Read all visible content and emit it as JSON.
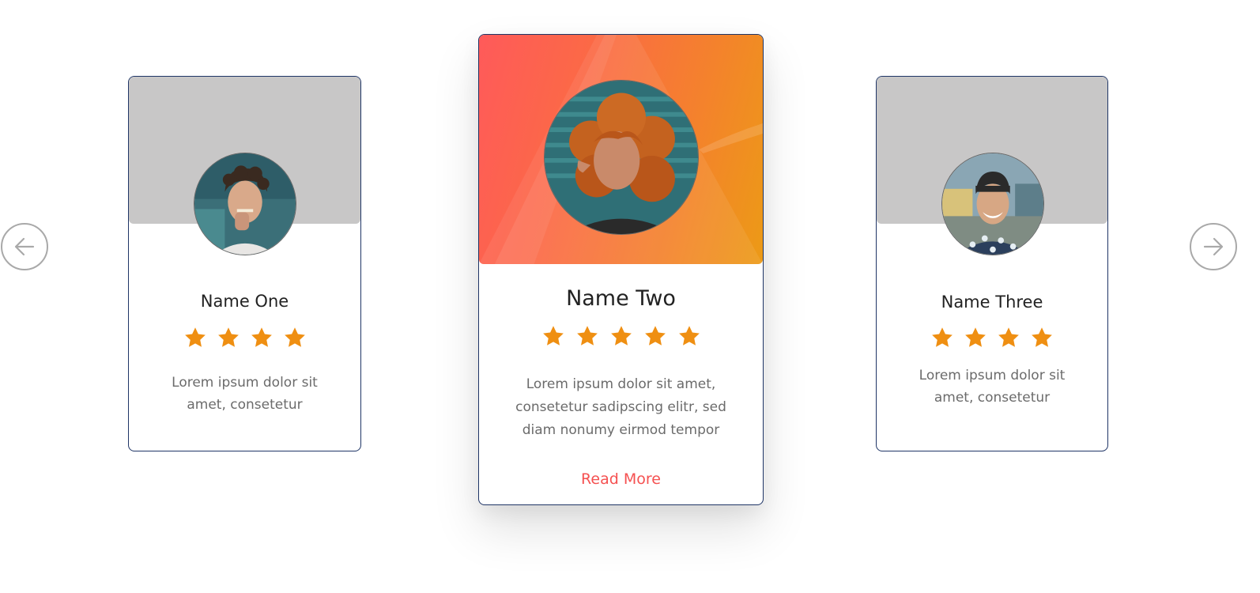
{
  "navigation": {
    "prev_icon": "arrow-left-icon",
    "next_icon": "arrow-right-icon",
    "arrow_color": "#a9a9a9"
  },
  "cards": [
    {
      "name": "Name One",
      "rating": 4,
      "text": "Lorem ipsum dolor sit amet, consetetur",
      "banner_color": "#c8c7c7"
    },
    {
      "name": "Name Two",
      "rating": 5,
      "text": "Lorem ipsum dolor sit amet, consetetur sadipscing elitr, sed diam nonumy eirmod tempor",
      "read_more_label": "Read More",
      "banner_gradient": [
        "#ff5a5a",
        "#ec9a16"
      ],
      "featured": true
    },
    {
      "name": "Name Three",
      "rating": 4,
      "text": "Lorem ipsum dolor sit amet, consetetur",
      "banner_color": "#c8c7c7"
    }
  ],
  "colors": {
    "star": "#ef8f12",
    "card_border": "#1f3566",
    "link": "#f55151",
    "name_text": "#222222",
    "body_text": "#6b6b6b"
  }
}
